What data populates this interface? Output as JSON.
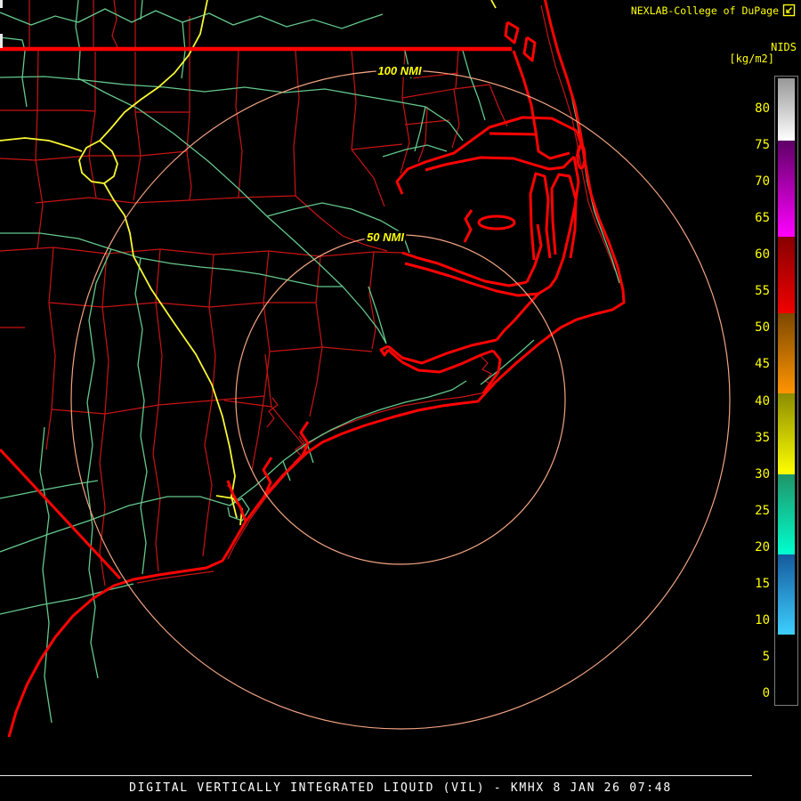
{
  "header": {
    "brand": "NEXLAB-College of DuPage",
    "brand_icon": "broken-image-icon",
    "product_code": "NIDS",
    "units": "[kg/m2]"
  },
  "map": {
    "ring_labels": [
      "50 NMI",
      "100 NMI"
    ],
    "ring_radii_nmi": [
      50,
      100
    ]
  },
  "colorbar": {
    "ticks": [
      80,
      75,
      70,
      65,
      60,
      55,
      50,
      45,
      40,
      35,
      30,
      25,
      20,
      15,
      10,
      5,
      0
    ],
    "segments": [
      {
        "from": 75.6,
        "to": 84.4,
        "color_top": "#989898",
        "color_bottom": "#ffffff"
      },
      {
        "from": 62.5,
        "to": 75.6,
        "color_top": "#5e0066",
        "color_bottom": "#ff00ff"
      },
      {
        "from": 52.0,
        "to": 62.5,
        "color_top": "#870000",
        "color_bottom": "#f00000"
      },
      {
        "from": 41.0,
        "to": 52.0,
        "color_top": "#7c4800",
        "color_bottom": "#ff9400"
      },
      {
        "from": 30.0,
        "to": 41.0,
        "color_top": "#8c8c00",
        "color_bottom": "#ffff00"
      },
      {
        "from": 19.0,
        "to": 30.0,
        "color_top": "#1f9468",
        "color_bottom": "#00ffcf"
      },
      {
        "from": 8.0,
        "to": 19.0,
        "color_top": "#155a9c",
        "color_bottom": "#3ecfff"
      },
      {
        "from": -1.5,
        "to": 8.0,
        "color_top": "#000000",
        "color_bottom": "#000000"
      }
    ]
  },
  "footer": {
    "title": "DIGITAL VERTICALLY INTEGRATED LIQUID (VIL) - KMHX 8 JAN 26 07:48"
  },
  "colors": {
    "background": "#000000",
    "county_lines": "#c81414",
    "coastline_state_lines": "#ff0202",
    "roads_primary": "#64c88c",
    "roads_highway": "#f8f832",
    "range_rings": "#f2a482",
    "labels": "#ffff00",
    "title_text": "#ffffff"
  }
}
